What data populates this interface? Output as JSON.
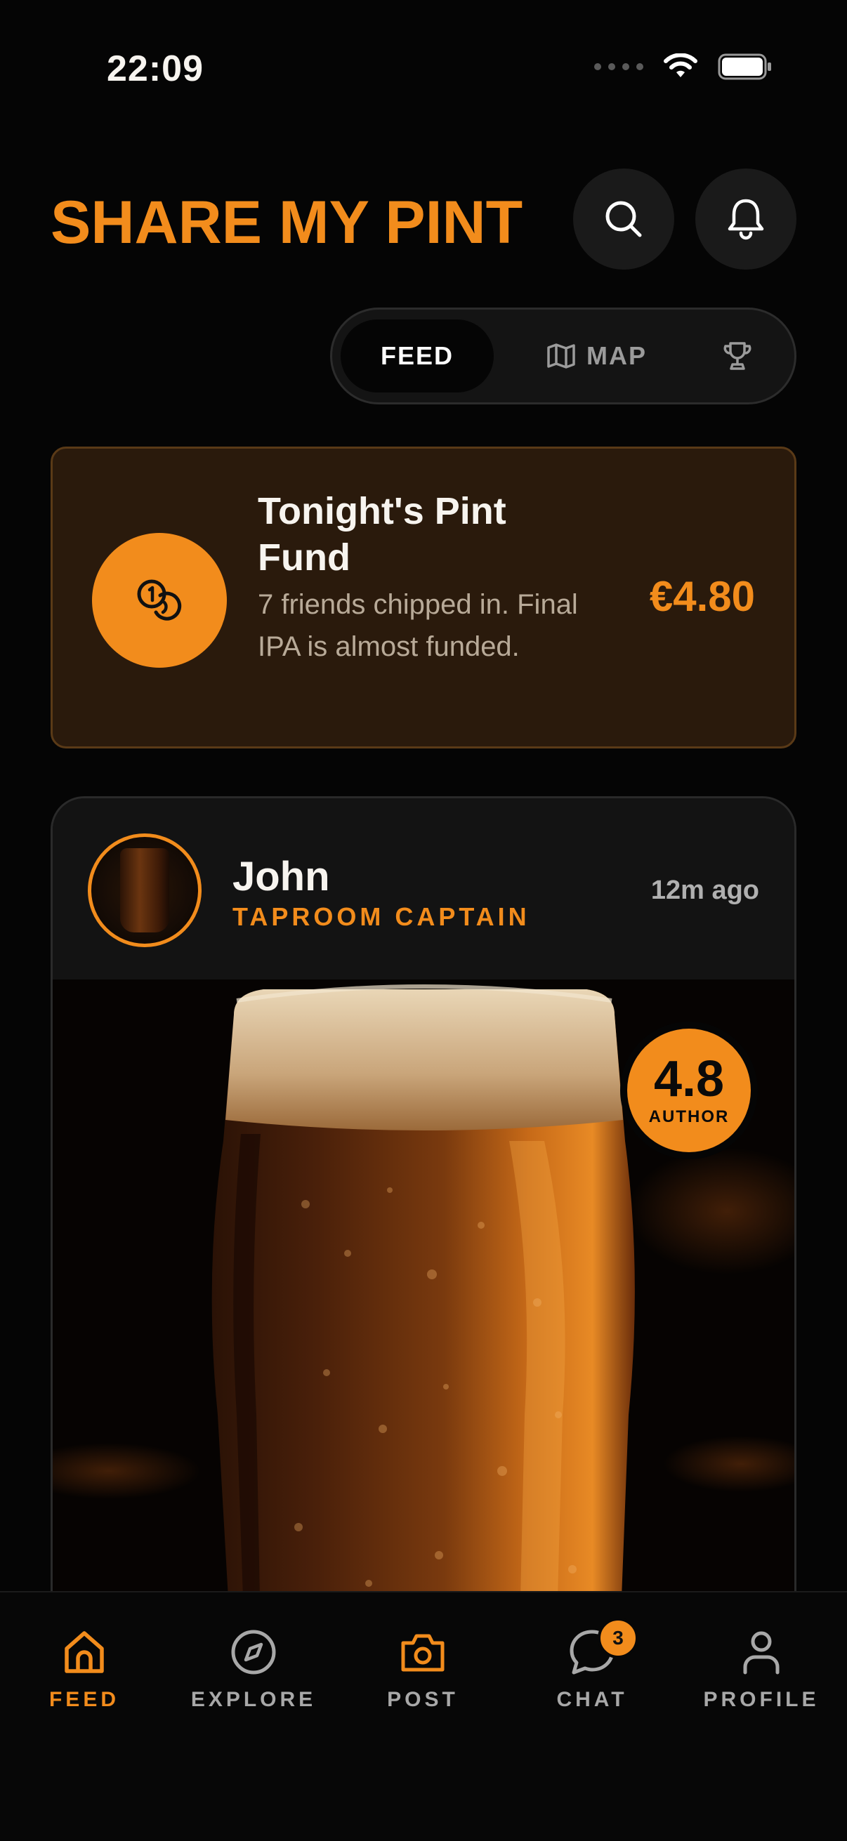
{
  "status_bar": {
    "time": "22:09"
  },
  "header": {
    "title": "SHARE MY PINT"
  },
  "segmented": {
    "feed": "FEED",
    "map": "MAP"
  },
  "fund": {
    "title": "Tonight's Pint Fund",
    "description": "7 friends chipped in. Final IPA is almost funded.",
    "amount": "€4.80"
  },
  "post": {
    "author": "John",
    "role": "TAPROOM CAPTAIN",
    "time": "12m ago",
    "rating_value": "4.8",
    "rating_label": "AUTHOR"
  },
  "nav": {
    "feed": "FEED",
    "explore": "EXPLORE",
    "post": "POST",
    "chat": "CHAT",
    "chat_badge": "3",
    "profile": "PROFILE"
  },
  "colors": {
    "accent": "#f28c1c",
    "background": "#050505"
  }
}
